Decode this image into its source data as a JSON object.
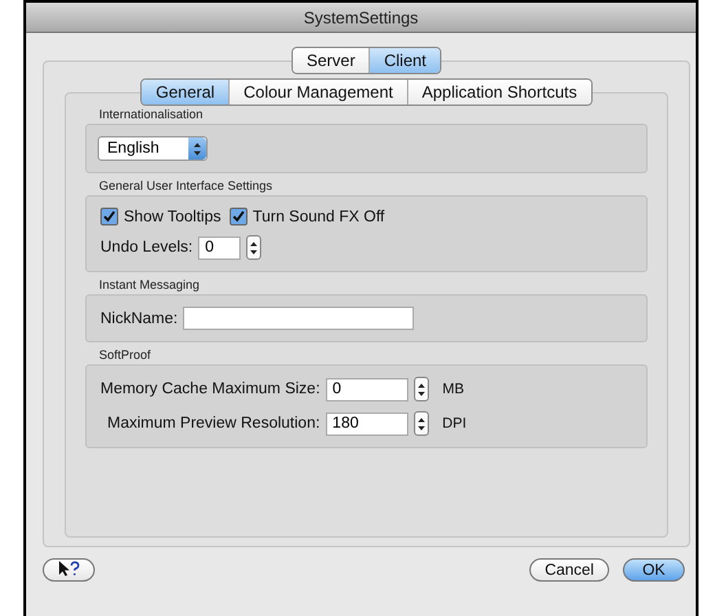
{
  "window": {
    "title": "SystemSettings"
  },
  "top_tabs": [
    {
      "label": "Server",
      "selected": false
    },
    {
      "label": "Client",
      "selected": true
    }
  ],
  "sub_tabs": [
    {
      "label": "General",
      "selected": true
    },
    {
      "label": "Colour Management",
      "selected": false
    },
    {
      "label": "Application Shortcuts",
      "selected": false
    }
  ],
  "groups": [
    {
      "title": "Internationalisation",
      "rows": [
        {
          "kind": "popup",
          "value": "English"
        }
      ]
    },
    {
      "title": "General User Interface Settings",
      "rows": [
        {
          "kind": "checkboxes",
          "items": [
            {
              "label": "Show Tooltips",
              "checked": true
            },
            {
              "label": "Turn Sound FX Off",
              "checked": true
            }
          ]
        },
        {
          "kind": "stepper",
          "label": "Undo Levels:",
          "value": "0"
        }
      ]
    },
    {
      "title": "Instant Messaging",
      "rows": [
        {
          "kind": "text",
          "label": "NickName:"
        }
      ]
    },
    {
      "title": "SoftProof",
      "rows": [
        {
          "kind": "stepper",
          "label": "Memory Cache Maximum Size:",
          "value": "0",
          "unit": "MB"
        },
        {
          "kind": "stepper",
          "label": "Maximum Preview Resolution:",
          "value": "180",
          "unit": "DPI"
        }
      ]
    }
  ],
  "buttons": [
    {
      "label": "Cancel",
      "default": false
    },
    {
      "label": "OK",
      "default": true
    }
  ]
}
